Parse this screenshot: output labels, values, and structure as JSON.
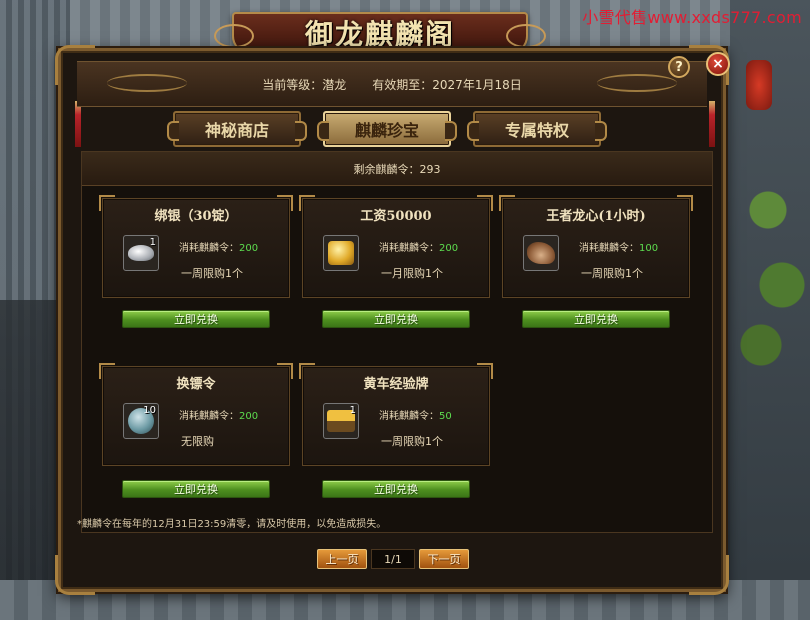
{
  "watermark": "小雪代售www.xxds777.com",
  "window_title": "御龙麒麟阁",
  "header": {
    "level_label": "当前等级：潜龙",
    "expiry_label": "有效期至：2027年1月18日"
  },
  "buttons": {
    "help": "?",
    "close": "×"
  },
  "tabs": [
    {
      "label": "神秘商店",
      "active": false
    },
    {
      "label": "麒麟珍宝",
      "active": true
    },
    {
      "label": "专属特权",
      "active": false
    }
  ],
  "remaining": "剩余麒麟令：293",
  "cost_label": "消耗麒麟令：",
  "redeem_label": "立即兑换",
  "items": [
    {
      "name": "绑银（30锭）",
      "quantity": "1",
      "icon": "silver-ingot-icon",
      "cost": "200",
      "limit": "一周限购1个"
    },
    {
      "name": "工资50000",
      "quantity": "",
      "icon": "gold-coins-icon",
      "cost": "200",
      "limit": "一月限购1个"
    },
    {
      "name": "王者龙心(1小时)",
      "quantity": "",
      "icon": "dragon-heart-icon",
      "cost": "100",
      "limit": "一周限购1个"
    },
    {
      "name": "换镖令",
      "quantity": "10",
      "icon": "escort-token-icon",
      "cost": "200",
      "limit": "无限购"
    },
    {
      "name": "黄车经验牌",
      "quantity": "1",
      "icon": "yellow-cart-icon",
      "cost": "50",
      "limit": "一周限购1个"
    }
  ],
  "notice": "*麒麟令在每年的12月31日23:59清零，请及时使用，以免造成损失。",
  "pager": {
    "prev": "上一页",
    "indicator": "1/1",
    "next": "下一页"
  },
  "colors": {
    "cost_value": "#5ddc4f",
    "redeem_button": "#4d8f1f",
    "pager_button": "#c67425",
    "close_button": "#c12a1c",
    "watermark": "#e21d33"
  }
}
